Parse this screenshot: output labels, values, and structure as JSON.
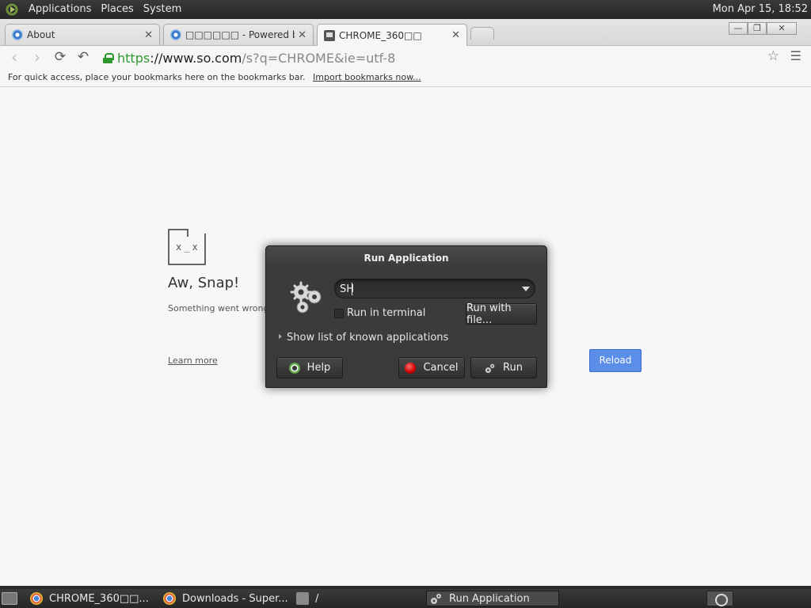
{
  "top_panel": {
    "menus": [
      "Applications",
      "Places",
      "System"
    ],
    "clock": "Mon Apr 15, 18:52"
  },
  "browser": {
    "tabs": [
      {
        "title": "About",
        "icon": "globe-icon"
      },
      {
        "title": "□□□□□□ - Powered by",
        "icon": "globe-icon"
      },
      {
        "title": "CHROME_360□□",
        "icon": "sad-tab-icon"
      }
    ],
    "url": {
      "scheme": "https",
      "host": "://www.so.com",
      "path": "/s?q=CHROME&ie=utf-8"
    },
    "bookmarks_bar": {
      "text": "For quick access, place your bookmarks here on the bookmarks bar.",
      "link": "Import bookmarks now..."
    },
    "page": {
      "title": "Aw, Snap!",
      "message": "Something went wrong",
      "learn_more": "Learn more",
      "reload": "Reload",
      "accent": "#5b8ee8"
    }
  },
  "dialog": {
    "title": "Run Application",
    "command": "SH",
    "run_in_terminal": "Run in terminal",
    "run_with_file": "Run with file...",
    "show_list": "Show list of known applications",
    "help": "Help",
    "cancel": "Cancel",
    "run": "Run"
  },
  "bottom_panel": {
    "tasks": [
      {
        "label": "CHROME_360□□...",
        "icon": "chrome-icon"
      },
      {
        "label": "Downloads - Super...",
        "icon": "chrome-icon"
      },
      {
        "label": "/",
        "icon": "folder-icon"
      },
      {
        "label": "Run Application",
        "icon": "run-icon"
      }
    ]
  }
}
